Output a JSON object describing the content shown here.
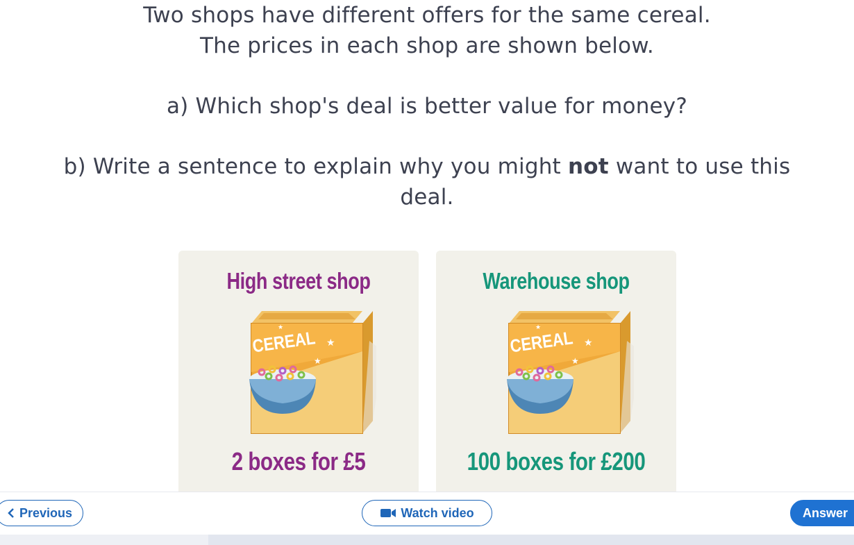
{
  "question": {
    "line1": "Two shops have different offers for the same cereal.",
    "line2": "The prices in each shop are shown below.",
    "part_a": "a) Which shop's deal is better value for money?",
    "part_b_prefix": "b) Write a sentence to explain why you might ",
    "part_b_bold": "not",
    "part_b_suffix": " want to use this",
    "part_b_line2": "deal."
  },
  "cards": [
    {
      "title": "High street shop",
      "box_text": "CEREAL",
      "price": "2 boxes for £5",
      "color": "#8b2a86"
    },
    {
      "title": "Warehouse shop",
      "box_text": "CEREAL",
      "price": "100 boxes for £200",
      "color": "#16967a"
    }
  ],
  "nav": {
    "previous_label": "Previous",
    "previous_icon": "chevron-left-icon",
    "video_label": "Watch video",
    "video_icon": "video-camera-icon",
    "answer_label": "Answer",
    "accent_color": "#1f72d2"
  }
}
